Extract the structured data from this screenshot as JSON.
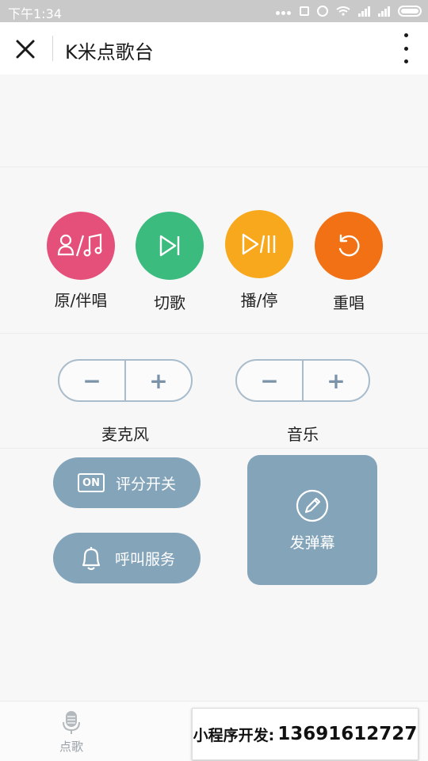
{
  "status_bar": {
    "time": "下午1:34"
  },
  "header": {
    "title": "K米点歌台"
  },
  "controls": [
    {
      "label": "原/伴唱",
      "color": "#e5507a",
      "icon": "vocal-accompaniment-icon"
    },
    {
      "label": "切歌",
      "color": "#3bbb7e",
      "icon": "skip-next-icon"
    },
    {
      "label": "播/停",
      "color": "#f7a81c",
      "icon": "play-pause-icon"
    },
    {
      "label": "重唱",
      "color": "#f27115",
      "icon": "replay-icon"
    }
  ],
  "volume": {
    "mic_label": "麦克风",
    "music_label": "音乐",
    "minus": "−",
    "plus": "+"
  },
  "actions": {
    "score_badge": "ON",
    "score_label": "评分开关",
    "call_label": "呼叫服务",
    "danmaku_label": "发弹幕"
  },
  "bottom": {
    "tab_label": "点歌",
    "ad_key": "小程序开发:",
    "ad_phone": "13691612727"
  },
  "colors": {
    "accent": "#84a4ba",
    "stepper_border": "#a8bccc"
  }
}
